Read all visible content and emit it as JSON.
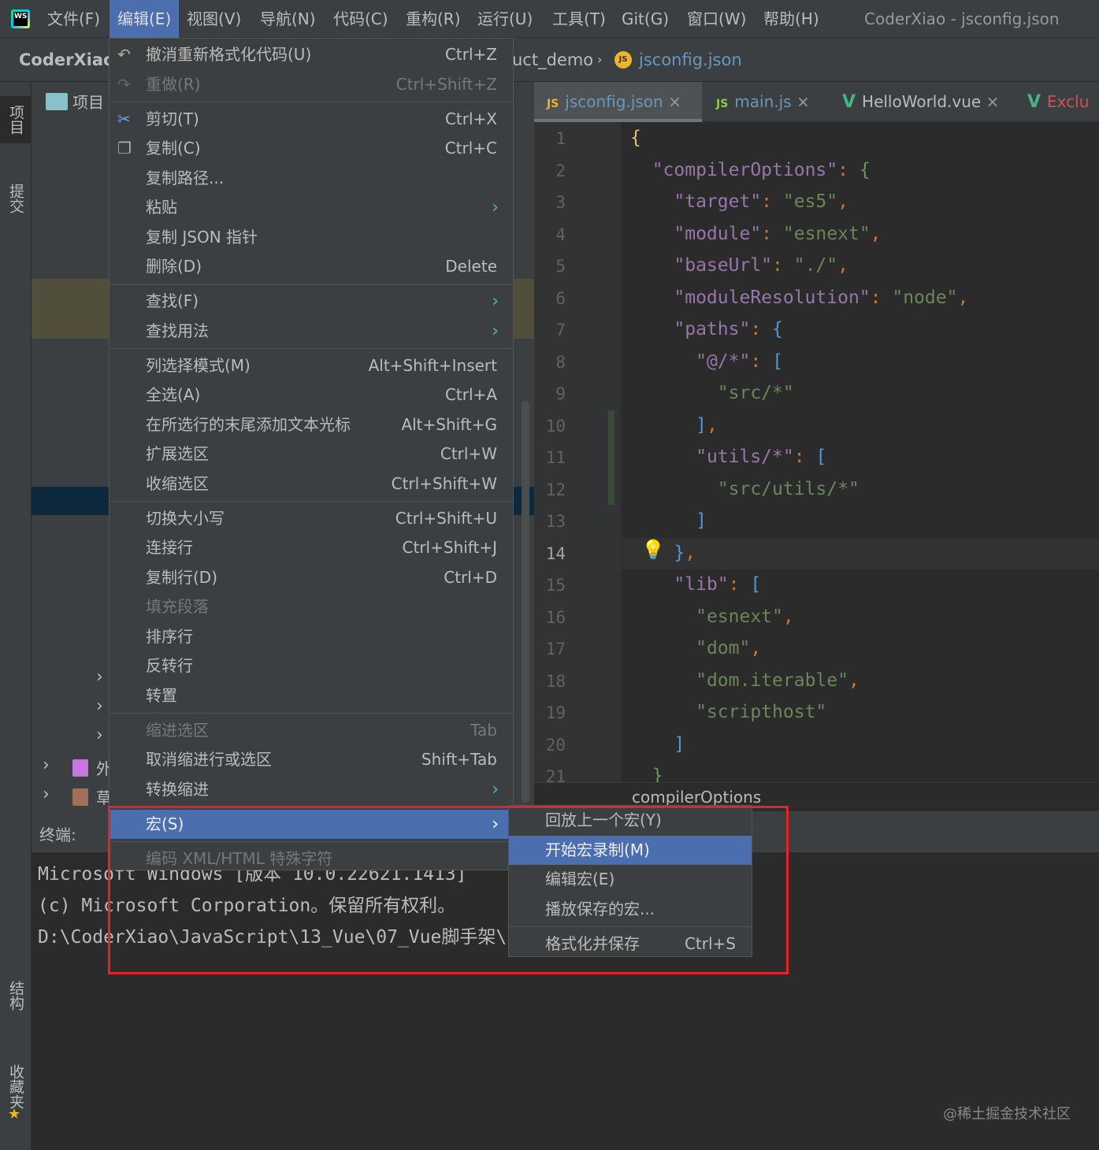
{
  "menubar": {
    "items": [
      "文件(F)",
      "编辑(E)",
      "视图(V)",
      "导航(N)",
      "代码(C)",
      "重构(R)",
      "运行(U)",
      "工具(T)",
      "Git(G)",
      "窗口(W)",
      "帮助(H)"
    ],
    "active": 1,
    "title": "CoderXiao - jsconfig.json"
  },
  "navbar": {
    "project": "CoderXiao",
    "breadcrumb": [
      "uct_demo",
      "jsconfig.json"
    ]
  },
  "left_strip": {
    "tabs": [
      "项目",
      "提交",
      "结构",
      "收藏夹"
    ]
  },
  "project_panel": {
    "title": "项目",
    "items": [
      "外",
      "草"
    ]
  },
  "tabs": [
    {
      "label": "jsconfig.json",
      "icon": "json-icon",
      "active": true
    },
    {
      "label": "main.js",
      "icon": "nodejs-icon"
    },
    {
      "label": "HelloWorld.vue",
      "icon": "vue-icon"
    },
    {
      "label": "Exclu",
      "icon": "vue-icon",
      "color": "#d25252"
    }
  ],
  "editor": {
    "current_line": 14,
    "breadcrumb": "compilerOptions",
    "lines": [
      "{",
      "  \"compilerOptions\": {",
      "    \"target\": \"es5\",",
      "    \"module\": \"esnext\",",
      "    \"baseUrl\": \"./\",",
      "    \"moduleResolution\": \"node\",",
      "    \"paths\": {",
      "      \"@/*\": [",
      "        \"src/*\"",
      "      ],",
      "      \"utils/*\": [",
      "        \"src/utils/*\"",
      "      ]",
      "    },",
      "    \"lib\": [",
      "      \"esnext\",",
      "      \"dom\",",
      "      \"dom.iterable\",",
      "      \"scripthost\"",
      "    ]",
      "  }"
    ]
  },
  "terminal": {
    "label": "终端:",
    "lines": [
      "Microsoft Windows [版本 10.0.22621.1413]",
      "(c) Microsoft Corporation。保留所有权利。",
      "D:\\CoderXiao\\JavaScript\\13_Vue\\07_Vue脚手架\\("
    ]
  },
  "edit_menu": {
    "items": [
      {
        "label": "撤消重新格式化代码(U)",
        "shortcut": "Ctrl+Z",
        "icon": "undo-icon"
      },
      {
        "label": "重做(R)",
        "shortcut": "Ctrl+Shift+Z",
        "icon": "redo-icon",
        "disabled": true,
        "sep_after": true
      },
      {
        "label": "剪切(T)",
        "shortcut": "Ctrl+X",
        "icon": "cut-icon"
      },
      {
        "label": "复制(C)",
        "shortcut": "Ctrl+C",
        "icon": "copy-icon"
      },
      {
        "label": "复制路径...",
        "shortcut": ""
      },
      {
        "label": "粘贴",
        "shortcut": "",
        "submenu": true
      },
      {
        "label": "复制 JSON 指针",
        "shortcut": ""
      },
      {
        "label": "删除(D)",
        "shortcut": "Delete",
        "sep_after": true
      },
      {
        "label": "查找(F)",
        "submenu": true
      },
      {
        "label": "查找用法",
        "submenu": true,
        "sep_after": true
      },
      {
        "label": "列选择模式(M)",
        "shortcut": "Alt+Shift+Insert"
      },
      {
        "label": "全选(A)",
        "shortcut": "Ctrl+A"
      },
      {
        "label": "在所选行的末尾添加文本光标",
        "shortcut": "Alt+Shift+G"
      },
      {
        "label": "扩展选区",
        "shortcut": "Ctrl+W"
      },
      {
        "label": "收缩选区",
        "shortcut": "Ctrl+Shift+W",
        "sep_after": true
      },
      {
        "label": "切换大小写",
        "shortcut": "Ctrl+Shift+U"
      },
      {
        "label": "连接行",
        "shortcut": "Ctrl+Shift+J"
      },
      {
        "label": "复制行(D)",
        "shortcut": "Ctrl+D"
      },
      {
        "label": "填充段落",
        "disabled": true
      },
      {
        "label": "排序行"
      },
      {
        "label": "反转行"
      },
      {
        "label": "转置",
        "sep_after": true
      },
      {
        "label": "缩进选区",
        "shortcut": "Tab",
        "disabled": true
      },
      {
        "label": "取消缩进行或选区",
        "shortcut": "Shift+Tab"
      },
      {
        "label": "转换缩进",
        "submenu": true,
        "sep_after": true
      },
      {
        "label": "宏(S)",
        "submenu": true,
        "selected": true,
        "sep_after": true
      },
      {
        "label": "编码 XML/HTML 特殊字符",
        "disabled": true
      }
    ]
  },
  "macro_submenu": {
    "items": [
      {
        "label": "回放上一个宏(Y)",
        "shortcut": ""
      },
      {
        "label": "开始宏录制(M)",
        "shortcut": "",
        "selected": true
      },
      {
        "label": "编辑宏(E)",
        "shortcut": ""
      },
      {
        "label": "播放保存的宏...",
        "shortcut": "",
        "sep_after": true
      },
      {
        "label": "格式化并保存",
        "shortcut": "Ctrl+S"
      }
    ]
  },
  "highlight_color": "#e0242c",
  "watermark": "@稀土掘金技术社区"
}
